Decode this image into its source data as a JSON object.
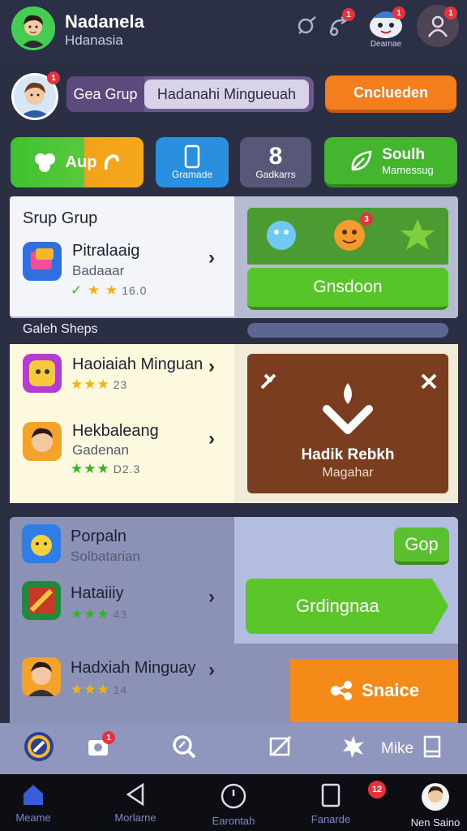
{
  "header": {
    "title": "Nadanela",
    "subtitle": "Hdanasia",
    "mascot_label": "Dearnae",
    "badges": [
      "1",
      "1",
      "1"
    ]
  },
  "top_row": {
    "badge": "1",
    "search_left": "Gea Grup",
    "search_right": "Hadanahi Mingueuah",
    "orange_button": "Cnclueden"
  },
  "tiles": {
    "green": "Aup",
    "blue_label": "Gramade",
    "purple_number": "8",
    "purple_label": "Gadkarrs",
    "green2_title": "Soulh",
    "green2_sub": "Mamessug"
  },
  "panel1": {
    "title": "Srup Grup",
    "item": {
      "title": "Pitralaaig",
      "sub": "Badaaar",
      "count": "16.0"
    },
    "reward_badge": "3",
    "green_button": "Gnsdoon",
    "strip_label": "Galeh Sheps"
  },
  "panel2": {
    "items": [
      {
        "title": "Haoiaiah Minguan",
        "count": "23"
      },
      {
        "title": "Hekbaleang",
        "sub": "Gadenan",
        "count": "D2.3"
      }
    ],
    "card_title": "Hadik Rebkh",
    "card_sub": "Magahar"
  },
  "panel3": {
    "items": [
      {
        "title": "Porpaln",
        "sub": "Solbatarian"
      },
      {
        "title": "Hataiiiy",
        "count": "43"
      },
      {
        "title": "Hadxiah Minguay",
        "count": "14"
      }
    ],
    "gop_button": "Gop",
    "arrow_button": "Grdingnaa",
    "orange_button": "Snaice"
  },
  "toolbar": {
    "badge": "1",
    "label": "Mike"
  },
  "bottom_nav": {
    "items": [
      "Meame",
      "Morlarne",
      "Earontah",
      "Fanarde",
      "Nen Saino"
    ],
    "badge": "12"
  },
  "colors": {
    "bg": "#2b2f44",
    "green": "#57c52a",
    "orange": "#f48a17",
    "brown": "#7a3d1f",
    "accent_nav": "#7f87c9",
    "badge": "#e8313a"
  }
}
